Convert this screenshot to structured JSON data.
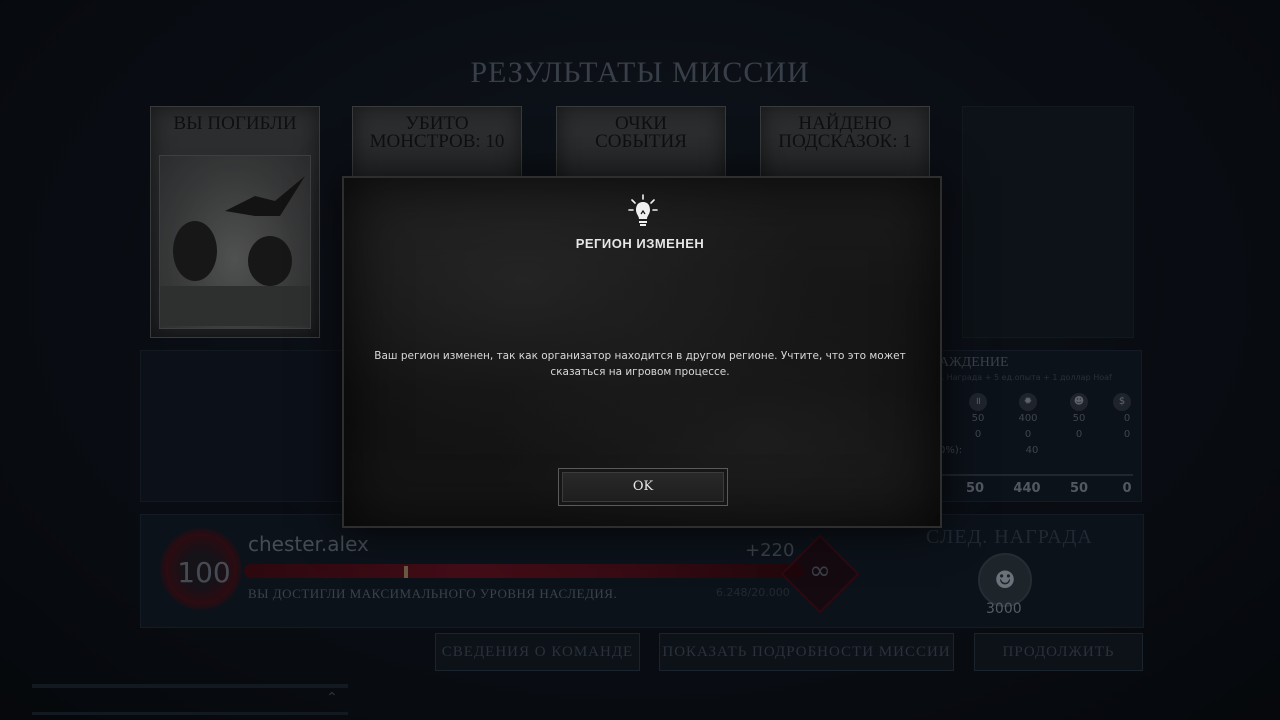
{
  "screen": {
    "title": "РЕЗУЛЬТАТЫ МИССИИ"
  },
  "cards": [
    {
      "title": "ВЫ ПОГИБЛИ"
    },
    {
      "title": "УБИТО\nМОНСТРОВ: 10"
    },
    {
      "title": "ОЧКИ\nСОБЫТИЯ"
    },
    {
      "title": "НАЙДЕНО\nПОДСКАЗОК: 1"
    }
  ],
  "reward_panel": {
    "title": "АЖДЕНИЕ",
    "subtitle": "1 Награда + 5 ед.опыта + 1 доллар Hoaf",
    "icons": [
      "pause-icon",
      "xp-badge-icon",
      "skull-coin-icon",
      "hunt-dollar-icon"
    ],
    "row1": [
      "50",
      "400",
      "50",
      "0"
    ],
    "row2": [
      "0",
      "0",
      "0",
      "0"
    ],
    "bonus_label": "0%):",
    "bonus_value": "40",
    "totals": [
      "50",
      "440",
      "50",
      "0"
    ]
  },
  "progress": {
    "level": "100",
    "username": "chester.alex",
    "xp_gain": "+220",
    "xp_total": "6.248/20.000",
    "max_level_text": "ВЫ ДОСТИГЛИ МАКСИМАЛЬНОГО УРОВНЯ НАСЛЕДИЯ.",
    "infinity": "∞",
    "next_reward_title": "СЛЕД. НАГРАДА",
    "next_reward_value": "3000"
  },
  "buttons": {
    "team_info": "СВЕДЕНИЯ О КОМАНДЕ",
    "mission_details": "ПОКАЗАТЬ ПОДРОБНОСТИ МИССИИ",
    "continue": "ПРОДОЛЖИТЬ"
  },
  "modal": {
    "icon": "lightbulb-icon",
    "title": "РЕГИОН ИЗМЕНЕН",
    "message": "Ваш регион изменен, так как организатор находится в другом регионе. Учтите, что это может сказаться на игровом процессе.",
    "ok_label": "OK"
  },
  "colors": {
    "accent_red": "#d31e1e",
    "xp_bar": "#5a1220",
    "background": "#0c1119"
  }
}
